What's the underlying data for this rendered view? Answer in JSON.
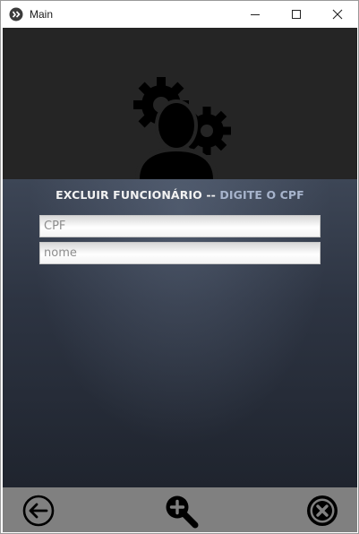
{
  "window": {
    "title": "Main",
    "icon": "kivy-logo-icon",
    "controls": [
      "minimize-icon",
      "maximize-icon",
      "close-icon"
    ]
  },
  "header": {
    "icon": "user-gears-icon"
  },
  "form": {
    "heading_main": "EXCLUIR FUNCIONÁRIO -- ",
    "heading_sub": "DIGITE O CPF",
    "cpf_placeholder": "CPF",
    "nome_placeholder": "nome"
  },
  "bottombar": {
    "back_icon": "arrow-left-circle-icon",
    "search_icon": "zoom-in-icon",
    "close_icon": "close-circle-icon"
  },
  "colors": {
    "header_bg": "#252525",
    "bottombar_bg": "#808080",
    "heading_sub": "#a7b4cc"
  }
}
